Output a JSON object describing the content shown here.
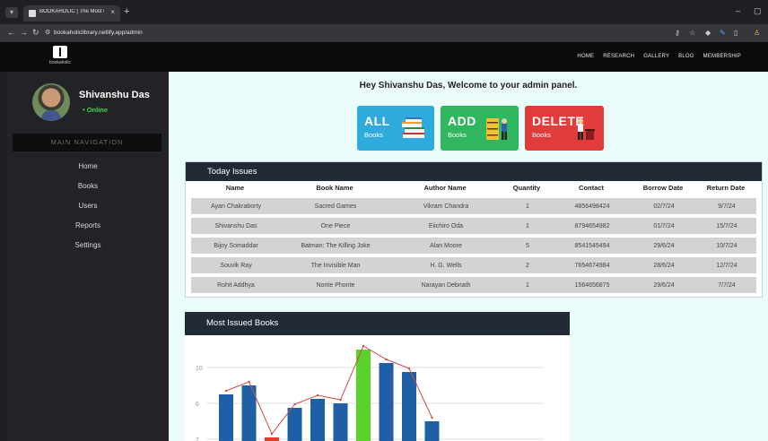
{
  "browser": {
    "tab_title": "BOOKAHOLIC | The Most Grea...",
    "tab_close": "×",
    "new_tab": "+",
    "url": "bookaholiclibrary.netlify.app/admin"
  },
  "site": {
    "logo_text": "bookaholic",
    "nav": [
      "HOME",
      "RESEARCH",
      "GALLERY",
      "BLOG",
      "MEMBERSHIP"
    ]
  },
  "sidebar": {
    "user_name": "Shivanshu Das",
    "status": "• Online",
    "section_title": "MAIN NAVIGATION",
    "items": [
      "Home",
      "Books",
      "Users",
      "Reports",
      "Settings"
    ]
  },
  "main": {
    "welcome": "Hey Shivanshu Das, Welcome to your admin panel.",
    "cards": [
      {
        "big": "ALL",
        "small": "Books",
        "color": "#2eaadc"
      },
      {
        "big": "ADD",
        "small": "Books",
        "color": "#2fb65e"
      },
      {
        "big": "DELETE",
        "small": "Books",
        "color": "#e13b3b"
      }
    ]
  },
  "issues": {
    "title": "Today Issues",
    "columns": [
      "Name",
      "Book Name",
      "Author Name",
      "Quantity",
      "Contact",
      "Borrow Date",
      "Return Date"
    ],
    "rows": [
      [
        "Ayan Chakraborty",
        "Sacred Games",
        "Vikram Chandra",
        "1",
        "4856498424",
        "02/7/24",
        "9/7/24"
      ],
      [
        "Shivanshu Das",
        "One Piece",
        "Eiichiro Oda",
        "1",
        "8794654982",
        "01/7/24",
        "15/7/24"
      ],
      [
        "Bijoy Somaddar",
        "Batman: The Killing Joke",
        "Alan Moore",
        "5",
        "8541545494",
        "29/6/24",
        "10/7/24"
      ],
      [
        "Souvik Ray",
        "The Invisible Man",
        "H. G. Wells",
        "2",
        "7654674984",
        "28/6/24",
        "12/7/24"
      ],
      [
        "Rohit Addhya",
        "Nonte Phonte",
        "Narayan Debnath",
        "1",
        "1564656875",
        "29/6/24",
        "7/7/24"
      ]
    ]
  },
  "chart_data": {
    "type": "bar",
    "title": "Most Issued Books",
    "y_ticks": [
      "0",
      "2",
      "6",
      "10"
    ],
    "ylim": [
      0,
      12
    ],
    "values": [
      7,
      8,
      2.2,
      5.5,
      6.5,
      6,
      12,
      10.5,
      9.5,
      4
    ],
    "line_values": [
      7,
      8,
      2.2,
      5.5,
      6.5,
      6,
      12,
      10.5,
      9.5,
      4
    ],
    "colors": [
      "#1f5fa6",
      "#1f5fa6",
      "#e03c31",
      "#1f5fa6",
      "#1f5fa6",
      "#1f5fa6",
      "#5bd12b",
      "#1f5fa6",
      "#1f5fa6",
      "#1f5fa6"
    ],
    "line_color": "#d04b4b",
    "grid": true,
    "legend": "none"
  }
}
